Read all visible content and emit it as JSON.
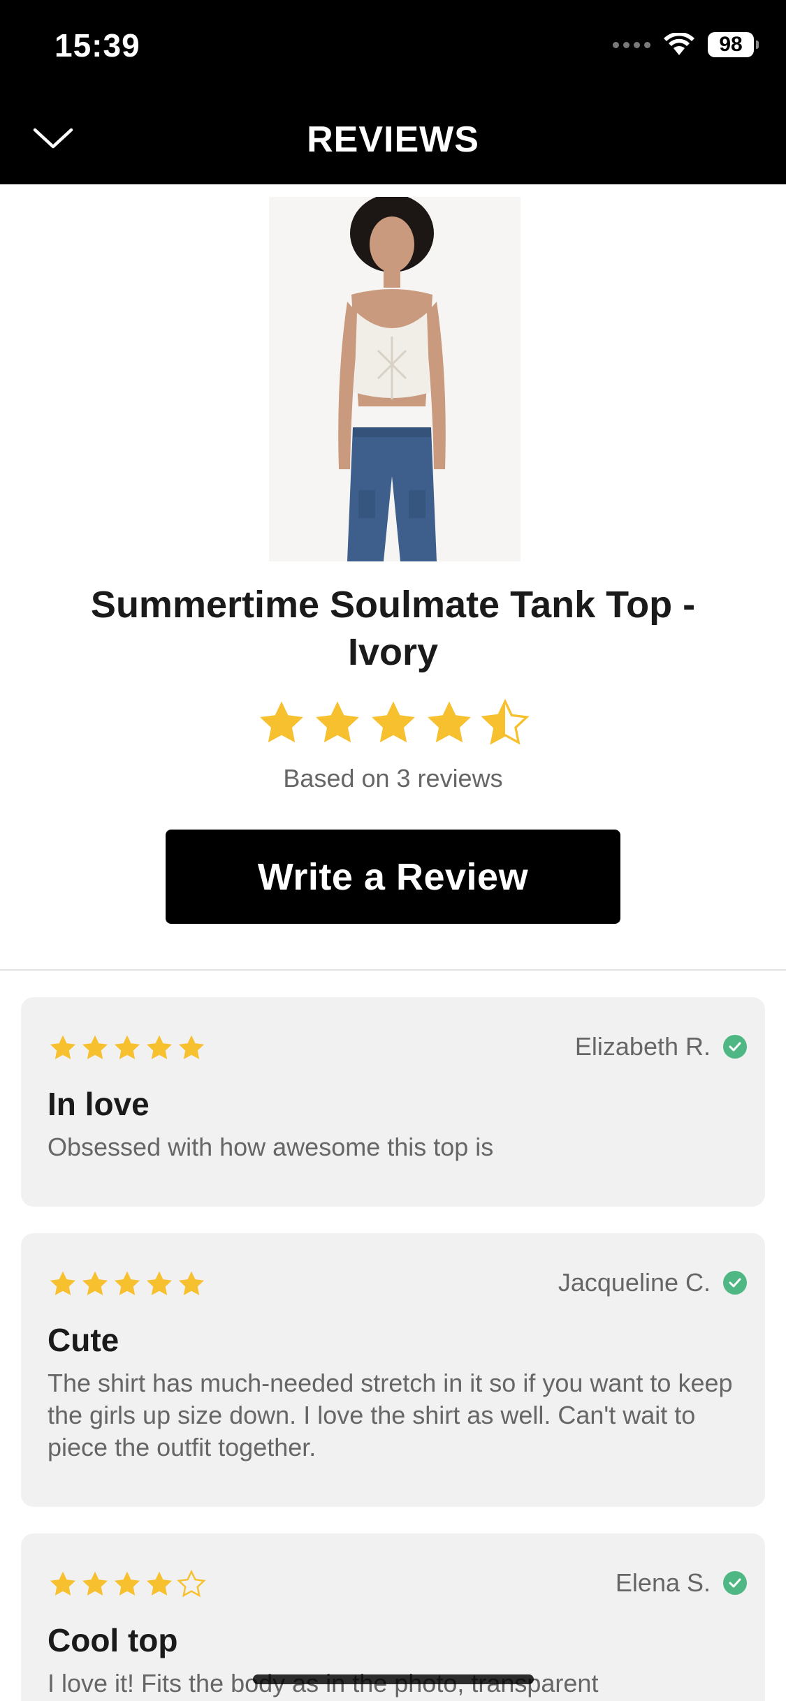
{
  "status_bar": {
    "time": "15:39",
    "battery": "98"
  },
  "header": {
    "title": "REVIEWS",
    "back_icon": "chevron-down-icon"
  },
  "product": {
    "title": "Summertime Soulmate Tank Top - Ivory",
    "rating": 4.5,
    "rating_text": "Based on 3 reviews"
  },
  "actions": {
    "write_review_label": "Write a Review"
  },
  "colors": {
    "star": "#f6c02f",
    "verified": "#4fb783",
    "header_bg": "#000000",
    "card_bg": "#f1f1f1"
  },
  "reviews": [
    {
      "rating": 5,
      "author": "Elizabeth R.",
      "title": "In love",
      "body": "Obsessed with how awesome this top is"
    },
    {
      "rating": 5,
      "author": "Jacqueline C.",
      "title": "Cute",
      "body": "The shirt has much-needed stretch in it so if you want to keep the girls up size down. I love the shirt as well. Can't wait to piece the outfit together."
    },
    {
      "rating": 4,
      "author": "Elena S.",
      "title": "Cool top",
      "body": "I love it! Fits the body as in the photo, transparent"
    }
  ]
}
